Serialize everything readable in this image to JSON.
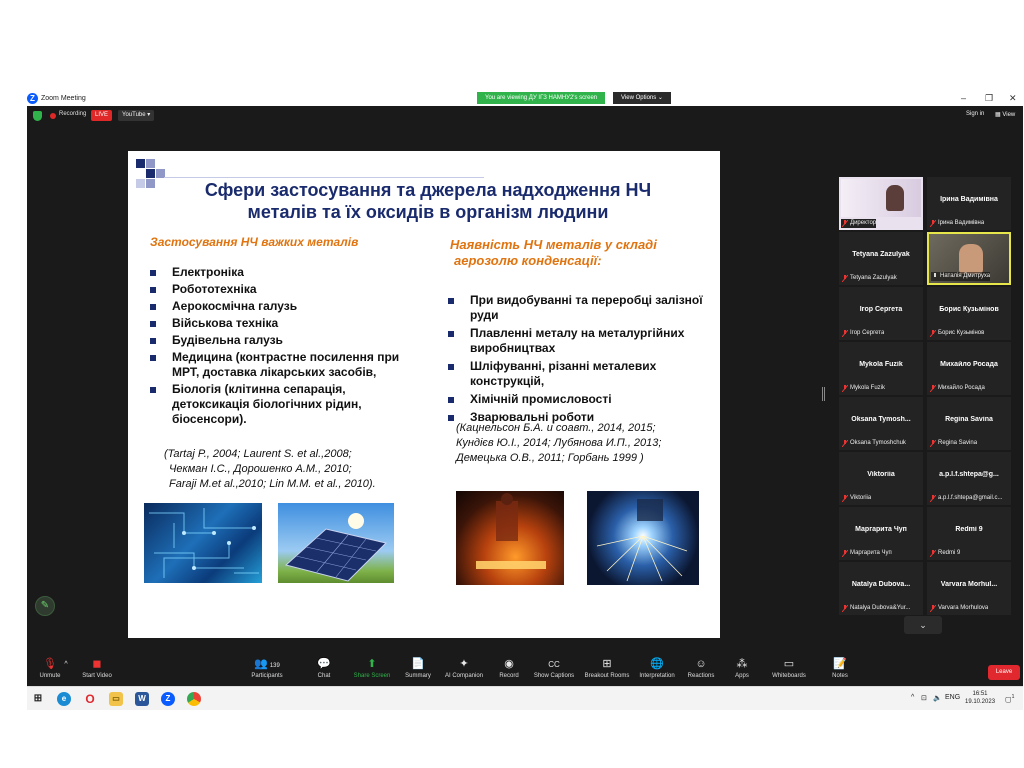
{
  "window": {
    "title": "Zoom Meeting",
    "viewing_banner": "You are viewing ДУ ІГЗ НАМНУ2's screen",
    "view_options": "View Options",
    "recording_label": "Recording",
    "live_label": "LIVE",
    "youtube_label": "YouTube",
    "signin_label": "Sign in",
    "view_label": "View"
  },
  "slide": {
    "title_line1": "Сфери застосування та джерела надходження НЧ",
    "title_line2": "металів та їх оксидів в організм людини",
    "left_heading": "Застосування НЧ важких металів",
    "left_items": [
      "Електроніка",
      "Робототехніка",
      "Аерокосмічна галузь",
      "Військова техніка",
      "Будівельна  галузь",
      "Медицина (контрастне посилення при МРТ, доставка лікарських засобів,",
      "Біологія (клітинна сепарація, детоксикація біологічних рідин, біосенсори)."
    ],
    "left_refs": [
      "(Tartaj P., 2004; Laurent S. et al.,2008;",
      "Чекман І.С., Дорошенко А.М., 2010;",
      "Faraji M.et al.,2010; Lin M.M. et al., 2010)."
    ],
    "right_heading_line1": "Наявність НЧ металів у складі",
    "right_heading_line2": "аерозолю конденсації:",
    "right_items": [
      "При видобуванні та переробці залізної руди",
      "Плавленні металу на металургійних виробництвах",
      "Шліфуванні, різанні металевих конструкцій,",
      "Хімічній промисловості",
      "Зварювальні роботи"
    ],
    "right_refs": [
      "(Кацнельсон Б.А. и соавт., 2014, 2015;",
      "Кундієв Ю.І., 2014; Лубянова И.П., 2013;",
      "Демецька О.В., 2011; Горбань  1999 )"
    ]
  },
  "participants": [
    {
      "name": "",
      "label": "Директор",
      "video": "thumb"
    },
    {
      "name": "Ірина Вадимівна",
      "label": "Ірина Вадимівна"
    },
    {
      "name": "Tetyana Zazulyak",
      "label": "Tetyana Zazulyak"
    },
    {
      "name": "",
      "label": "Наталія Дмитруха",
      "video": "cam"
    },
    {
      "name": "Ігор Сергета",
      "label": "Ігор Сергета"
    },
    {
      "name": "Борис Кузьмінов",
      "label": "Борис Кузьмінов"
    },
    {
      "name": "Mykola Fuzik",
      "label": "Mykola Fuzik"
    },
    {
      "name": "Михайло Росада",
      "label": "Михайло Росада"
    },
    {
      "name": "Oksana  Tymosh...",
      "label": "Oksana Tymoshchuk"
    },
    {
      "name": "Regina Savina",
      "label": "Regina Savina"
    },
    {
      "name": "Viktoriia",
      "label": "Viktoriia"
    },
    {
      "name": "a.p.l.f.shtepa@g...",
      "label": "a.p.l.f.shtepa@gmail.c..."
    },
    {
      "name": "Маргарита Чуп",
      "label": "Маргарита Чуп"
    },
    {
      "name": "Redmi 9",
      "label": "Redmi 9"
    },
    {
      "name": "Natalya  Dubova...",
      "label": "Natalya Dubova&Yur..."
    },
    {
      "name": "Varvara  Morhul...",
      "label": "Varvara Morhulova"
    }
  ],
  "toolbar": {
    "unmute": "Unmute",
    "start_video": "Start Video",
    "participants": "Participants",
    "participants_count": "139",
    "chat": "Chat",
    "share_screen": "Share Screen",
    "summary": "Summary",
    "ai_companion": "AI Companion",
    "record": "Record",
    "show_captions": "Show Captions",
    "breakout_rooms": "Breakout Rooms",
    "interpretation": "Interpretation",
    "reactions": "Reactions",
    "apps": "Apps",
    "whiteboards": "Whiteboards",
    "notes": "Notes",
    "leave": "Leave"
  },
  "taskbar": {
    "language": "ENG",
    "time": "16:51",
    "date": "19.10.2023",
    "notifications": "1"
  },
  "colors": {
    "zoom_blue": "#0b5cff",
    "banner_green": "#2fb34a",
    "leave_red": "#e0282e",
    "slide_title": "#1a2b6d",
    "slide_heading": "#e07410"
  }
}
